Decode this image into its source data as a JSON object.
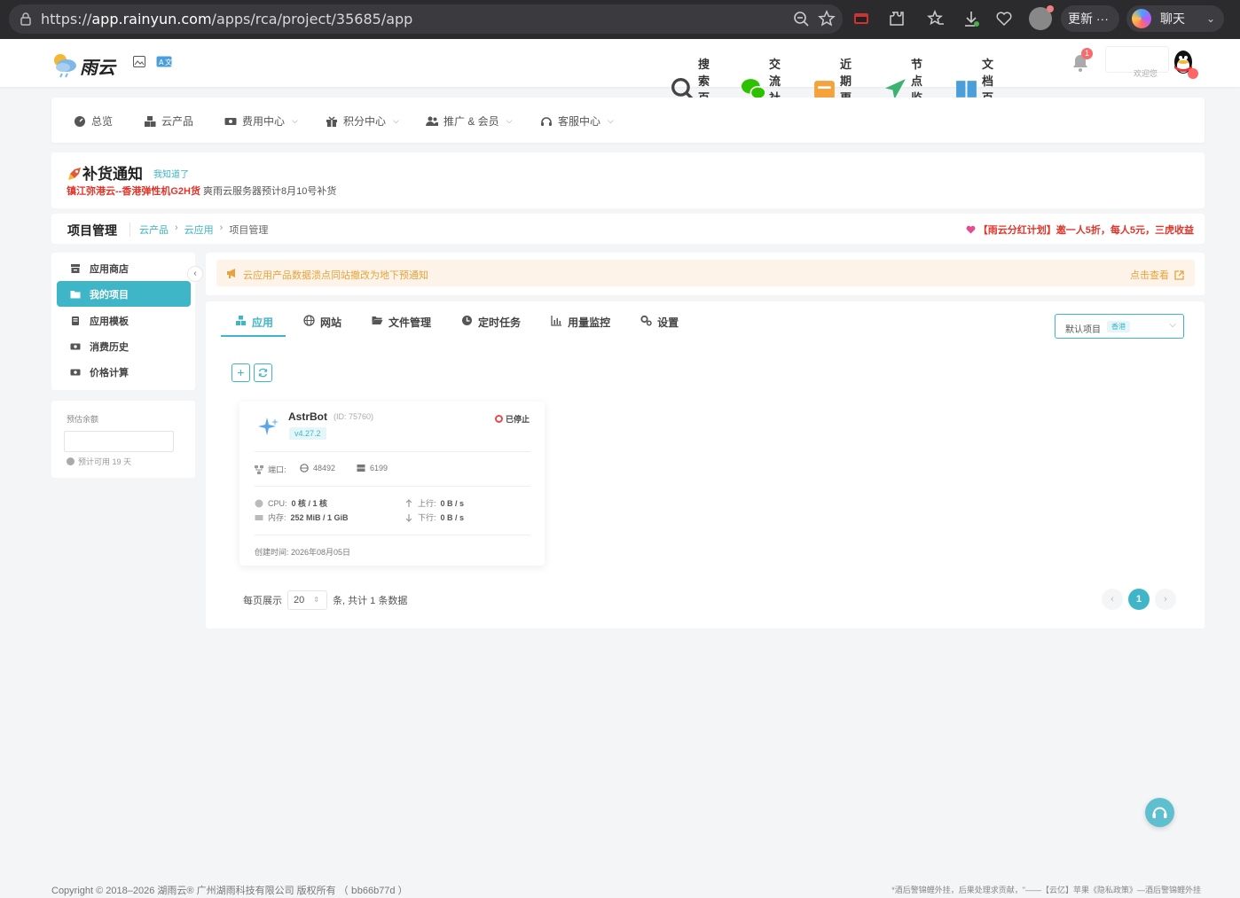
{
  "browser": {
    "url_prefix": "https://",
    "url_host": "app.rainyun.com",
    "url_path": "/apps/rca/project/35685/app",
    "update_label": "更新 ···",
    "chat_label": "聊天"
  },
  "header": {
    "logo_text": "雨云",
    "links": [
      {
        "label": "搜索百科",
        "icon": "search-icon"
      },
      {
        "label": "交流社区",
        "icon": "wechat-icon"
      },
      {
        "label": "近期更新",
        "icon": "update-icon"
      },
      {
        "label": "节点监控",
        "icon": "plane-icon"
      },
      {
        "label": "文档百科",
        "icon": "book-icon"
      }
    ],
    "notification_count": "1",
    "welcome": "欢迎您"
  },
  "menu": [
    {
      "label": "总览",
      "icon": "dashboard-icon",
      "dropdown": false
    },
    {
      "label": "云产品",
      "icon": "cubes-icon",
      "dropdown": false
    },
    {
      "label": "费用中心",
      "icon": "money-icon",
      "dropdown": true
    },
    {
      "label": "积分中心",
      "icon": "gift-icon",
      "dropdown": true
    },
    {
      "label": "推广 & 会员",
      "icon": "users-icon",
      "dropdown": true
    },
    {
      "label": "客服中心",
      "icon": "headset-icon",
      "dropdown": true
    }
  ],
  "notice": {
    "title": "补货通知",
    "dismiss": "我知道了",
    "highlight": "镇江弥港云--香港弹性机G2H货",
    "text": " 爽雨云服务器预计8月10号补货"
  },
  "page": {
    "title": "项目管理",
    "breadcrumb": [
      "云产品",
      "云应用",
      "项目管理"
    ],
    "promo": "【雨云分红计划】邀一人5折，每人5元，三虎收益"
  },
  "sidebar": {
    "items": [
      {
        "label": "应用商店",
        "icon": "store-icon"
      },
      {
        "label": "我的项目",
        "icon": "folder-icon",
        "active": true
      },
      {
        "label": "应用模板",
        "icon": "template-icon"
      },
      {
        "label": "消费历史",
        "icon": "receipt-icon"
      },
      {
        "label": "价格计算",
        "icon": "calculator-icon"
      }
    ],
    "balance_label": "预估余额",
    "balance_value": "",
    "balance_hint": "预计可用 19 天"
  },
  "alert": {
    "message": "云应用产品数据溃点同站撤改为地下预通知",
    "link": "点击查看"
  },
  "tabs": [
    {
      "label": "应用",
      "icon": "apps-icon",
      "active": true
    },
    {
      "label": "网站",
      "icon": "globe-icon"
    },
    {
      "label": "文件管理",
      "icon": "folder-open-icon"
    },
    {
      "label": "定时任务",
      "icon": "clock-icon"
    },
    {
      "label": "用量监控",
      "icon": "chart-icon"
    },
    {
      "label": "设置",
      "icon": "gears-icon"
    }
  ],
  "project_select": {
    "label": "默认项目",
    "tag": "香港"
  },
  "app_card": {
    "name": "AstrBot",
    "id": "(ID: 75760)",
    "version": "v4.27.2",
    "status": "已停止",
    "ports_label": "端口:",
    "port1": "48492",
    "port2": "6199",
    "cpu_label": "CPU:",
    "cpu_value": "0 核 / 1 核",
    "mem_label": "内存:",
    "mem_value": "252 MiB / 1 GiB",
    "up_label": "上行:",
    "up_value": "0 B / s",
    "down_label": "下行:",
    "down_value": "0 B / s",
    "created": "创建时间: 2026年08月05日"
  },
  "pagination": {
    "prefix": "每页展示",
    "page_size": "20",
    "suffix": "条, 共计 1 条数据",
    "current_page": "1"
  },
  "footer": {
    "copyright": "Copyright © 2018–2026 湖雨云® 广州湖雨科技有限公司 版权所有 （ 𝖻b66b77d ）",
    "right": "*酒后警锦鲤外挂，后果处理求贡献，\"——【云亿】苹果《隐私政策》—酒后警锦鲤外挂"
  },
  "colors": {
    "accent": "#3fb6c8",
    "danger": "#e0352b",
    "warning": "#e8a33a"
  }
}
